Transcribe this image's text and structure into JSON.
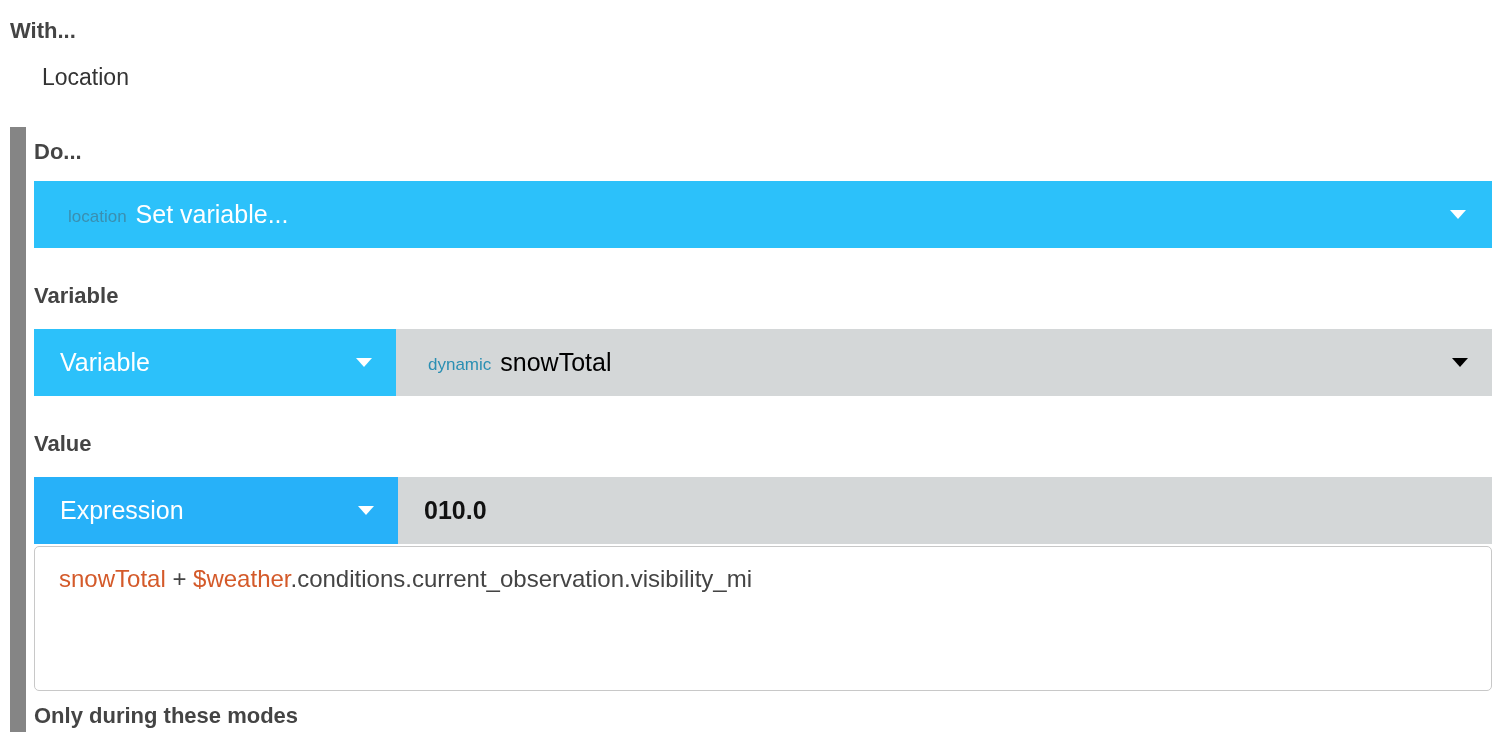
{
  "with": {
    "label": "With...",
    "item": "Location"
  },
  "do": {
    "label": "Do...",
    "action": {
      "prefix": "location",
      "value": "Set variable..."
    }
  },
  "variable": {
    "label": "Variable",
    "type": "Variable",
    "prefix": "dynamic",
    "value": "snowTotal"
  },
  "value": {
    "label": "Value",
    "type": "Expression",
    "result": "010.0",
    "expression": [
      {
        "kind": "variable",
        "text": "snowTotal"
      },
      {
        "kind": "text",
        "text": " + "
      },
      {
        "kind": "variable",
        "text": "$weather"
      },
      {
        "kind": "text",
        "text": ".conditions.current_observation.visibility_mi"
      }
    ]
  },
  "modes": {
    "label": "Only during these modes"
  }
}
